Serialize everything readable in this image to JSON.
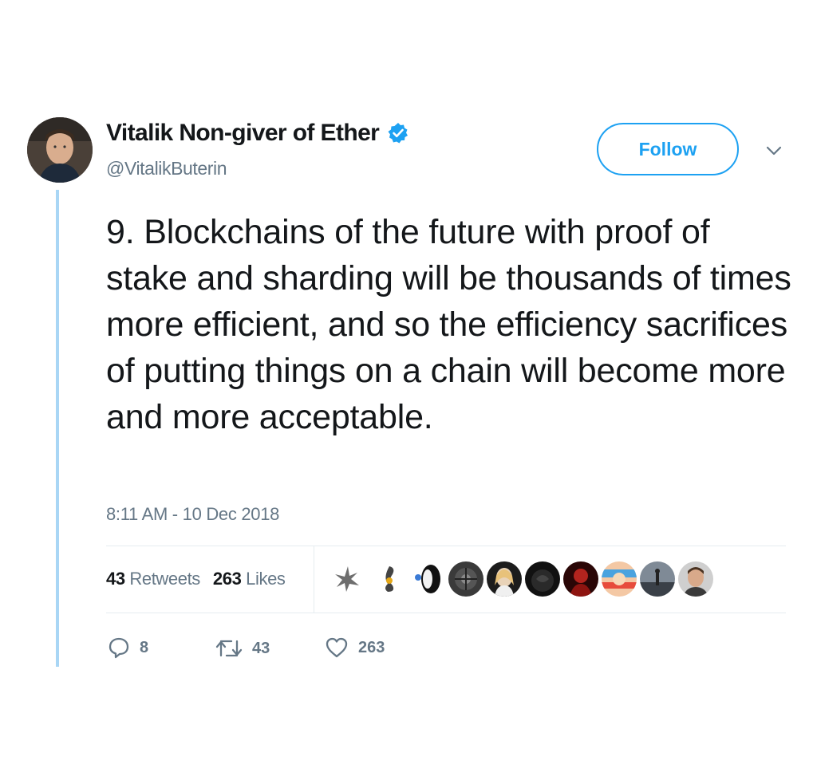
{
  "header": {
    "display_name": "Vitalik Non-giver of Ether",
    "handle": "@VitalikButerin",
    "follow_label": "Follow"
  },
  "tweet": {
    "text": "9. Blockchains of the future with proof of stake and sharding will be thousands of times more efficient, and so the efficiency sacrifices of putting things on a chain will become more and more acceptable.",
    "timestamp": "8:11 AM - 10 Dec 2018"
  },
  "stats": {
    "retweets_count": "43",
    "retweets_label": "Retweets",
    "likes_count": "263",
    "likes_label": "Likes"
  },
  "actions": {
    "reply_count": "8",
    "retweet_count": "43",
    "like_count": "263"
  },
  "icons": {
    "verified": "verified-badge-icon",
    "caret": "chevron-down-icon",
    "reply": "reply-icon",
    "retweet": "retweet-icon",
    "like": "heart-icon"
  },
  "colors": {
    "accent": "#1da1f2",
    "thread_line": "#a9d6f5",
    "secondary_text": "#657786"
  }
}
